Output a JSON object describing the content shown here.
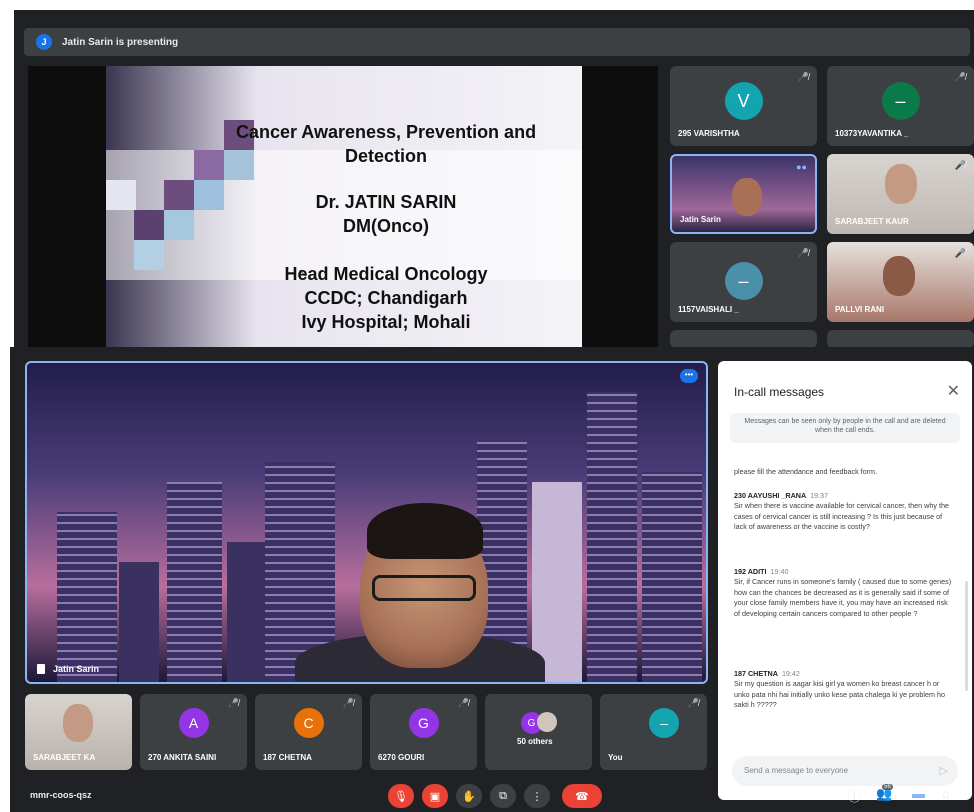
{
  "top": {
    "presenting_avatar": "J",
    "presenting_text": "Jatin Sarin is presenting",
    "slide": {
      "line1": "Cancer Awareness, Prevention and",
      "line2": "Detection",
      "line3": "Dr. JATIN SARIN",
      "line4": "DM(Onco)",
      "line5": "Head Medical Oncology",
      "line6": "CCDC; Chandigarh",
      "line7": "Ivy Hospital; Mohali"
    },
    "tiles": [
      {
        "name": "295 VARISHTHA",
        "avatar": "V",
        "color": "#12a4af"
      },
      {
        "name": "10373YAVANTIKA _",
        "avatar": "–",
        "color": "#0b7a4b"
      },
      {
        "name": "Jatin Sarin",
        "avatar": "",
        "color": ""
      },
      {
        "name": "SARABJEET KAUR",
        "avatar": "",
        "color": ""
      },
      {
        "name": "1157VAISHALI _",
        "avatar": "–",
        "color": "#4a90a8"
      },
      {
        "name": "PALLVI RANI",
        "avatar": "",
        "color": ""
      }
    ]
  },
  "bottom": {
    "main_speaker": "Jatin Sarin",
    "more_label": "•••",
    "strip": [
      {
        "name": "SARABJEET KA",
        "avatar": "",
        "color": ""
      },
      {
        "name": "270 ANKITA SAINI",
        "avatar": "A",
        "color": "#9334e6"
      },
      {
        "name": "187 CHETNA",
        "avatar": "C",
        "color": "#e8710a"
      },
      {
        "name": "6270 GOURI",
        "avatar": "G",
        "color": "#9334e6"
      },
      {
        "name": "50 others",
        "avatar": "G",
        "color": "#9334e6"
      },
      {
        "name": "You",
        "avatar": "–",
        "color": "#12a4af"
      }
    ],
    "chat": {
      "title": "In-call messages",
      "note": "Messages can be seen only by people in the call and are deleted when the call ends.",
      "messages": [
        {
          "who": "",
          "time": "",
          "text": "please fill the attendance and feedback form."
        },
        {
          "who": "230 AAYUSHI _RANA",
          "time": "19:37",
          "text": "Sir when there is vaccine available for cervical cancer, then why the cases of cervical cancer is still increasing ? Is this just because of lack of awareness or the vaccine is costly?"
        },
        {
          "who": "192 ADITI",
          "time": "19:40",
          "text": "Sir, if Cancer runs in someone's family ( caused due to some genes) how can the chances be decreased as it is generally said if some of your close family members have it, you may have an increased risk of developing certain cancers compared to other people ?"
        },
        {
          "who": "187 CHETNA",
          "time": "19:42",
          "text": "Sir my question is aagar kisi girl ya women ko breast cancer h or unko pata nhi hai initially unko kese pata chalega ki ye problem ho sakti h ?????"
        }
      ],
      "input_placeholder": "Send a message to everyone"
    },
    "controls": {
      "meeting_code": "mmr-coos-qsz",
      "people_count": "56"
    }
  }
}
